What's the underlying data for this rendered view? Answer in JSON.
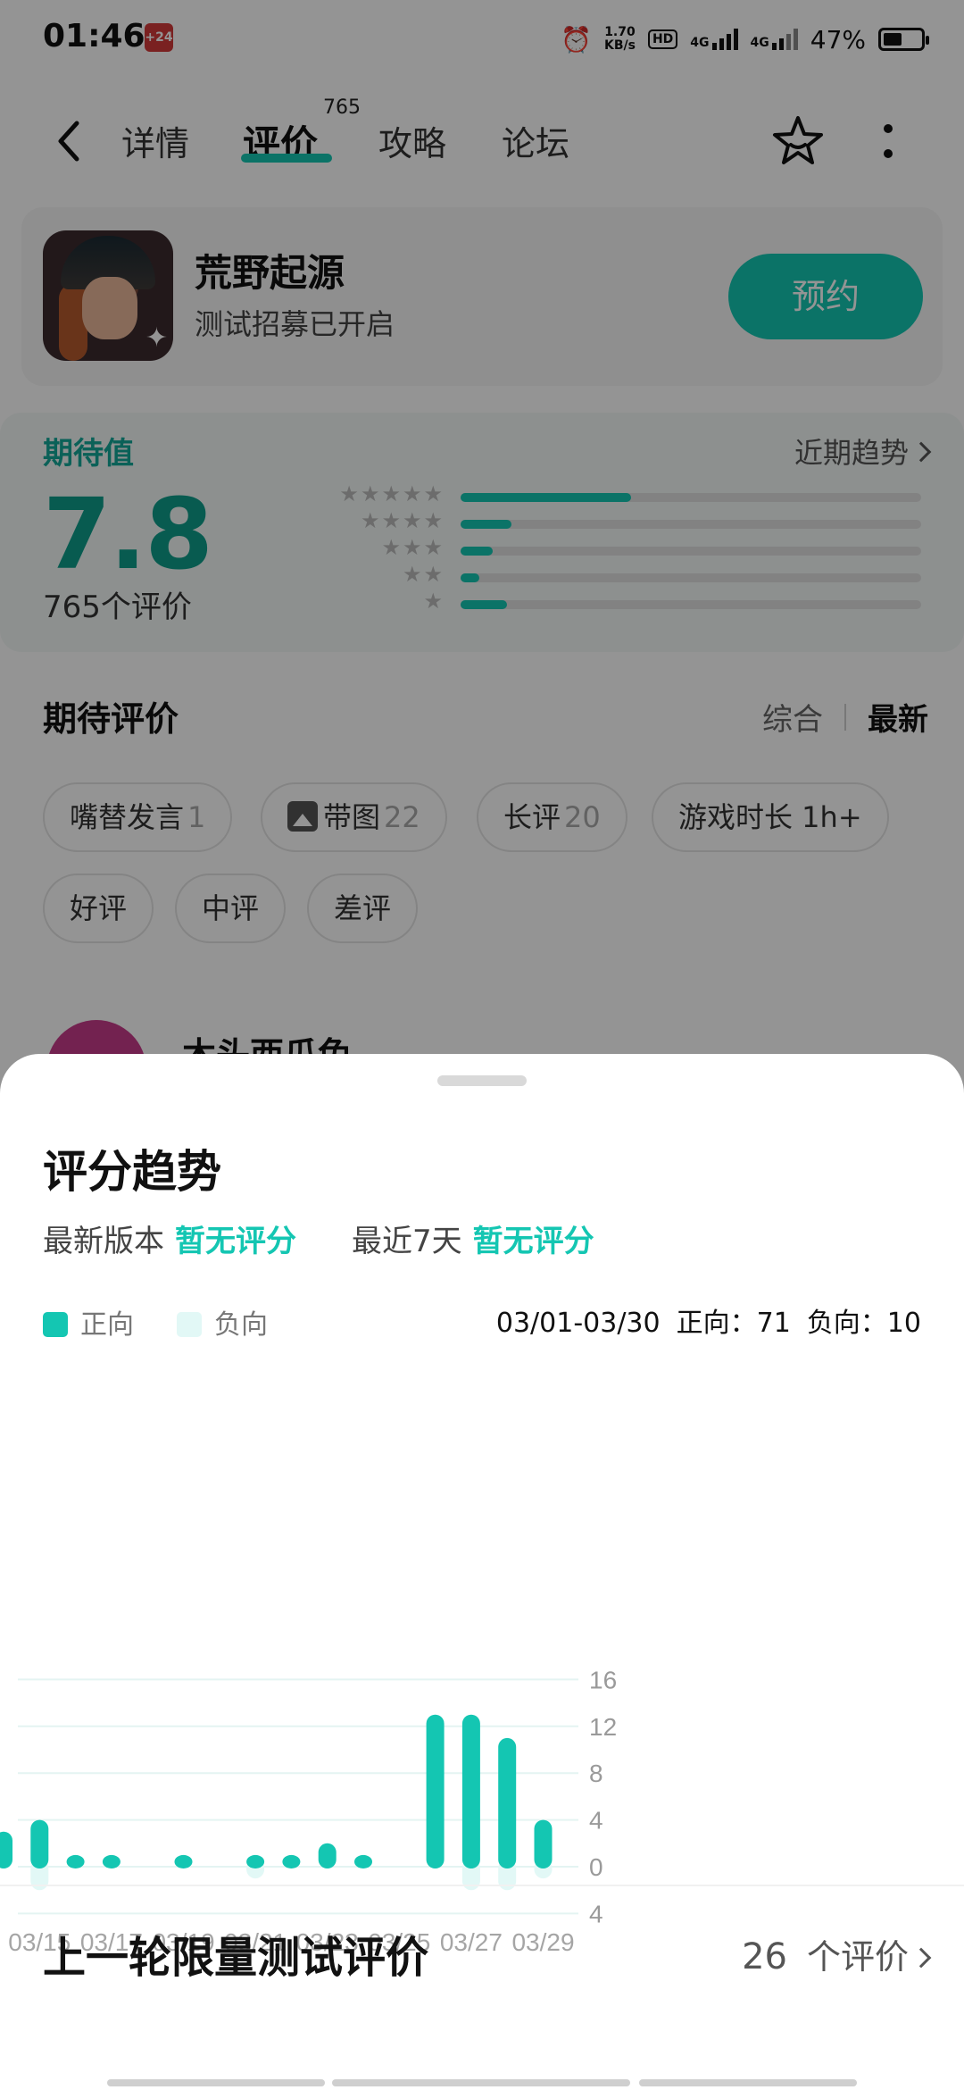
{
  "status": {
    "time": "01:46",
    "notif": "+24",
    "speed_top": "1.70",
    "speed_bottom": "KB/s",
    "hd": "HD",
    "net1": "4G",
    "net2": "4G",
    "battery": "47%"
  },
  "nav": {
    "tabs": [
      {
        "label": "详情"
      },
      {
        "label": "评价",
        "badge": "765"
      },
      {
        "label": "攻略"
      },
      {
        "label": "论坛"
      }
    ]
  },
  "game": {
    "title": "荒野起源",
    "subtitle": "测试招募已开启",
    "reserve_label": "预约"
  },
  "rating": {
    "label": "期待值",
    "score": "7.8",
    "count": "765个评价",
    "trend_link": "近期趋势",
    "distribution": [
      {
        "stars": 5,
        "fraction": 0.37
      },
      {
        "stars": 4,
        "fraction": 0.11
      },
      {
        "stars": 3,
        "fraction": 0.07
      },
      {
        "stars": 2,
        "fraction": 0.04
      },
      {
        "stars": 1,
        "fraction": 0.1
      }
    ]
  },
  "reviews": {
    "heading": "期待评价",
    "sort": [
      "综合",
      "最新"
    ],
    "filters": [
      {
        "label": "嘴替发言",
        "count": "1"
      },
      {
        "label": "带图",
        "count": "22"
      },
      {
        "label": "长评",
        "count": "20"
      },
      {
        "label": "游戏时长 1h+",
        "count": ""
      },
      {
        "label": "好评",
        "count": ""
      },
      {
        "label": "中评",
        "count": ""
      },
      {
        "label": "差评",
        "count": ""
      }
    ],
    "first_reviewer": "木头西瓜兔"
  },
  "sheet": {
    "title": "评分趋势",
    "latest_version_label": "最新版本",
    "latest_version_value": "暂无评分",
    "last7_label": "最近7天",
    "last7_value": "暂无评分",
    "legend_positive": "正向",
    "legend_negative": "负向",
    "range": "03/01-03/30",
    "positive_total": "正向：71",
    "negative_total": "负向：10",
    "prev_title": "上一轮限量测试评价",
    "prev_count": "26",
    "prev_unit": "个评价"
  },
  "colors": {
    "accent": "#14c6b2",
    "negative": "#e2f8f6"
  },
  "chart_data": {
    "type": "bar",
    "x": [
      "03/14",
      "03/15",
      "03/16",
      "03/17",
      "03/18",
      "03/19",
      "03/20",
      "03/21",
      "03/22",
      "03/23",
      "03/24",
      "03/25",
      "03/26",
      "03/27",
      "03/28",
      "03/29",
      "03/30"
    ],
    "xtick_labels": [
      "03/15",
      "03/17",
      "03/19",
      "03/21",
      "03/23",
      "03/25",
      "03/27",
      "03/29"
    ],
    "series": [
      {
        "name": "正向",
        "values": [
          3,
          4,
          1,
          1,
          0,
          1,
          0,
          1,
          1,
          2,
          1,
          0,
          13,
          13,
          11,
          4,
          0
        ]
      },
      {
        "name": "负向",
        "values": [
          0,
          2,
          0,
          0,
          0,
          0,
          0,
          1,
          0,
          0,
          0,
          0,
          0,
          2,
          2,
          1,
          0
        ]
      }
    ],
    "yticks": [
      16,
      12,
      8,
      4,
      0,
      4
    ],
    "ylim": [
      -4,
      16
    ],
    "grid": true
  }
}
